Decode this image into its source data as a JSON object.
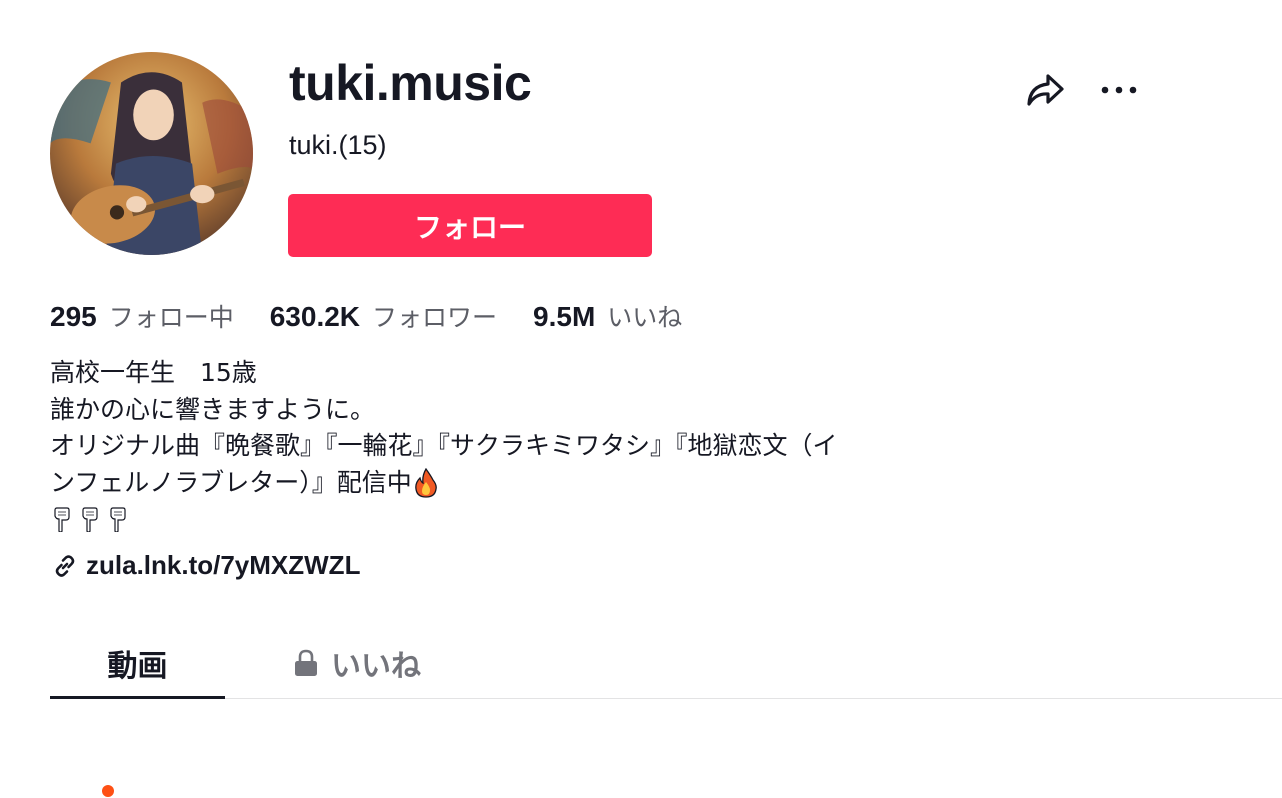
{
  "profile": {
    "username": "tuki.music",
    "nickname": "tuki.(15)",
    "follow_label": "フォロー"
  },
  "icons": {
    "share": "share-arrow-icon",
    "more": "more-dots-icon",
    "link": "link-chain-icon",
    "lock": "lock-icon"
  },
  "stats": [
    {
      "value": "295",
      "label": "フォロー中"
    },
    {
      "value": "630.2K",
      "label": "フォロワー"
    },
    {
      "value": "9.5M",
      "label": "いいね"
    }
  ],
  "bio": {
    "line1": "高校一年生　15歳",
    "line2": "誰かの心に響きますように。",
    "line3": "オリジナル曲『晩餐歌』『一輪花』『サクラキミワタシ』『地獄恋文（イ",
    "line4": "ンフェルノラブレター）』配信中"
  },
  "link": {
    "text": "zula.lnk.to/7yMXZWZL"
  },
  "tabs": [
    {
      "label": "動画",
      "active": true
    },
    {
      "label": "いいね",
      "locked": true
    }
  ],
  "colors": {
    "accent": "#fe2c55",
    "text": "#161823",
    "muted": "#5c5e66",
    "indicator": "#fe5014"
  }
}
